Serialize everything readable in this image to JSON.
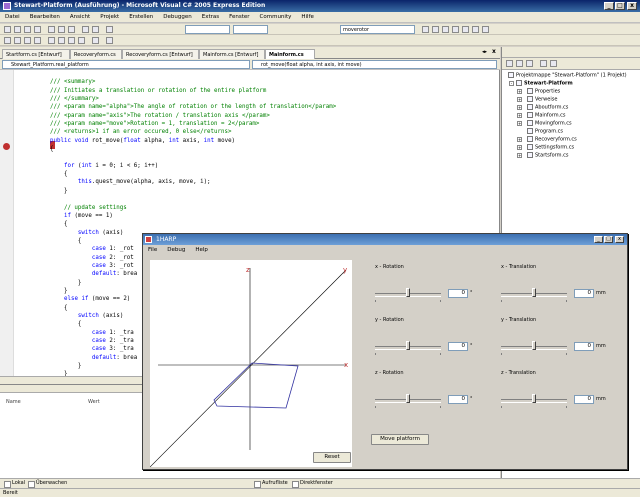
{
  "window": {
    "title": "Stewart-Platform (Ausführung) - Microsoft Visual C# 2005 Express Edition",
    "min": "_",
    "max": "□",
    "close": "x"
  },
  "menu": [
    "Datei",
    "Bearbeiten",
    "Ansicht",
    "Projekt",
    "Erstellen",
    "Debuggen",
    "Extras",
    "Fenster",
    "Community",
    "Hilfe"
  ],
  "toolbar": {
    "search_value": "moverotor"
  },
  "doc_tabs": [
    {
      "label": "Startform.cs [Entwurf]",
      "active": false
    },
    {
      "label": "Recoveryform.cs",
      "active": false
    },
    {
      "label": "Recoveryform.cs [Entwurf]",
      "active": false
    },
    {
      "label": "Mainform.cs [Entwurf]",
      "active": false
    },
    {
      "label": "Mainform.cs",
      "active": true
    }
  ],
  "doc_close": "x",
  "nav": {
    "class_select": "Stewart_Platform.real_platform",
    "member_select": "rot_move(float alpha, int axis, int move)"
  },
  "code": {
    "l01": "/// <summary>",
    "l02": "/// Initiates a translation or rotation of the entire platform",
    "l03": "/// </summary>",
    "l04": "/// <param name=\"alpha\">The angle of rotation or the length of translation</param>",
    "l05": "/// <param name=\"axis\">The rotation / translation axis </param>",
    "l06": "/// <param name=\"move\">Rotation = 1, translation = 2</param>",
    "l07": "/// <returns>1 if an error occured, 0 else</returns>",
    "l08": "public void rot_move(float alpha, int axis, int move)",
    "l09": "{",
    "l10": "",
    "l11": "    for (int i = 0; i < 6; i++)",
    "l12": "    {",
    "l13": "        this.quest_move(alpha, axis, move, i);",
    "l14": "    }",
    "l15": "",
    "l16": "    // update settings",
    "l17": "    if (move == 1)",
    "l18": "    {",
    "l19": "        switch (axis)",
    "l20": "        {",
    "l21": "            case 1: _rot",
    "l22": "            case 2: _rot",
    "l23": "            case 3: _rot",
    "l24": "            default: brea",
    "l25": "        }",
    "l26": "    }",
    "l27": "    else if (move == 2)",
    "l28": "    {",
    "l29": "        switch (axis)",
    "l30": "        {",
    "l31": "            case 1: _tra",
    "l32": "            case 2: _tra",
    "l33": "            case 3: _tra",
    "l34": "            default: brea",
    "l35": "        }",
    "l36": "    }",
    "l37": "}"
  },
  "locals": {
    "col_name": "Name",
    "col_value": "Wert"
  },
  "bottom_tabs": [
    "Lokal",
    "Überwachen",
    "Aufrufliste",
    "Direktfenster"
  ],
  "status": "Bereit",
  "solution": {
    "root": "Projektmappe \"Stewart-Platform\" (1 Projekt)",
    "project": "Stewart-Platform",
    "items": [
      "Properties",
      "Verweise",
      "Aboutform.cs",
      "Mainform.cs",
      "Movingform.cs",
      "Program.cs",
      "Recoveryform.cs",
      "Settingsform.cs",
      "Startsform.cs"
    ],
    "expander_plus": "+",
    "expander_minus": "-"
  },
  "harp": {
    "title": "1HARP",
    "min": "_",
    "max": "□",
    "close": "x",
    "menu": [
      "File",
      "Debug",
      "Help"
    ],
    "axes": {
      "z": "z",
      "y": "y",
      "x": "x"
    },
    "controls": [
      {
        "label": "x - Rotation",
        "value": "0",
        "unit": "°"
      },
      {
        "label": "x - Translation",
        "value": "0",
        "unit": "mm"
      },
      {
        "label": "y - Rotation",
        "value": "0",
        "unit": "°"
      },
      {
        "label": "y - Translation",
        "value": "0",
        "unit": "mm"
      },
      {
        "label": "z - Rotation",
        "value": "0",
        "unit": "°"
      },
      {
        "label": "z - Translation",
        "value": "0",
        "unit": "mm"
      }
    ],
    "reset_label": "Reset",
    "move_label": "Move platform"
  }
}
